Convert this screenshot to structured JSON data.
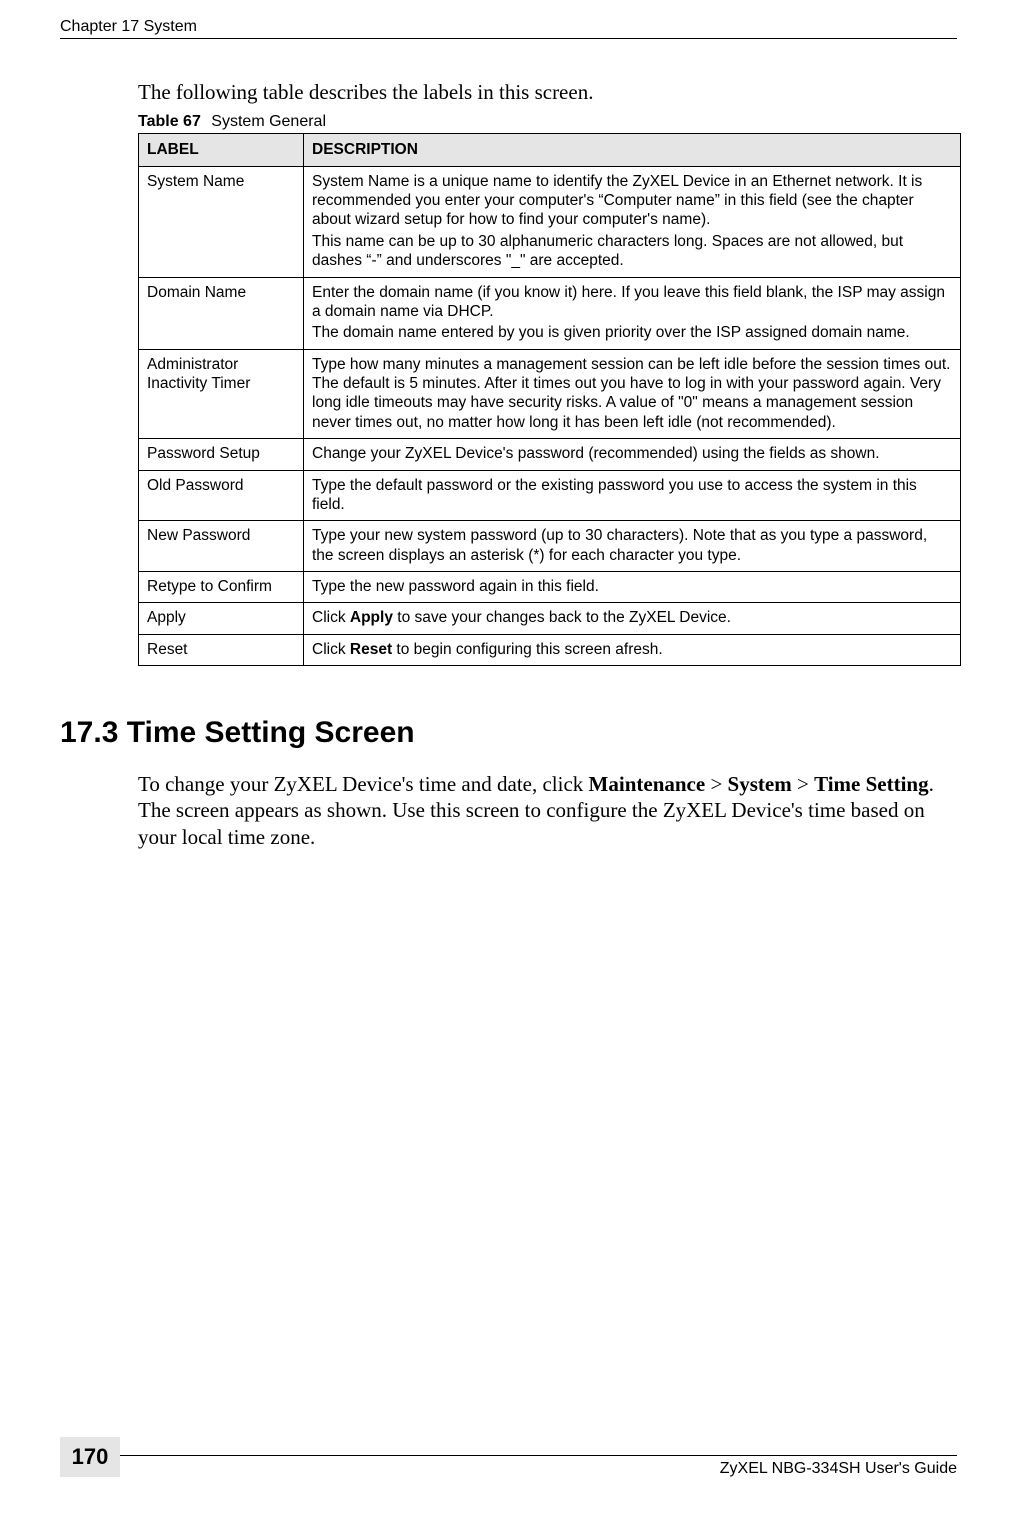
{
  "header": {
    "chapter": "Chapter 17 System"
  },
  "intro": "The following table describes the labels in this screen.",
  "table": {
    "caption_prefix": "Table 67",
    "caption_title": "System General",
    "headers": {
      "label": "LABEL",
      "description": "DESCRIPTION"
    },
    "rows": [
      {
        "label": "System Name",
        "desc": [
          "System Name is a unique name to identify the ZyXEL Device in an Ethernet network. It is recommended you enter your computer's “Computer name” in this field (see the chapter about wizard setup for how to find your computer's name).",
          "This name can be up to 30 alphanumeric characters long. Spaces are not allowed, but dashes “-” and underscores \"_\" are accepted."
        ]
      },
      {
        "label": "Domain Name",
        "desc": [
          "Enter the domain name (if you know it) here. If you leave this field blank, the ISP may assign a domain name via DHCP.",
          "The domain name entered by you is given priority over the ISP assigned domain name."
        ]
      },
      {
        "label": "Administrator Inactivity Timer",
        "desc": [
          "Type how many minutes a management session can be left idle before the session times out. The default is 5 minutes. After it times out you have to log in with your password again. Very long idle timeouts may have security risks. A value of \"0\" means a management session never times out, no matter how long it has been left idle (not recommended)."
        ]
      },
      {
        "label": "Password Setup",
        "desc": [
          "Change your ZyXEL Device's password (recommended) using the fields as shown."
        ]
      },
      {
        "label": "Old Password",
        "desc": [
          "Type the default password or the existing password you use to access the system in this field."
        ]
      },
      {
        "label": "New Password",
        "desc": [
          "Type your new system password (up to 30 characters). Note that as you type a password, the screen displays an asterisk (*) for each character you type."
        ]
      },
      {
        "label": "Retype to Confirm",
        "desc": [
          "Type the new password again in this field."
        ]
      },
      {
        "label": "Apply",
        "desc_bold": "Apply",
        "desc_prefix": "Click ",
        "desc_suffix": " to save your changes back to the ZyXEL Device."
      },
      {
        "label": "Reset",
        "desc_bold": "Reset",
        "desc_prefix": "Click ",
        "desc_suffix": " to begin configuring this screen afresh."
      }
    ]
  },
  "section": {
    "heading": "17.3  Time Setting Screen",
    "body_pre": "To change your ZyXEL Device's time and date, click ",
    "b1": "Maintenance",
    "gt1": " > ",
    "b2": "System",
    "gt2": " > ",
    "b3": "Time Setting",
    "body_post": ". The screen appears as shown. Use this screen to configure the ZyXEL Device's time based on your local time zone."
  },
  "footer": {
    "page_number": "170",
    "guide": "ZyXEL NBG-334SH User's Guide"
  }
}
